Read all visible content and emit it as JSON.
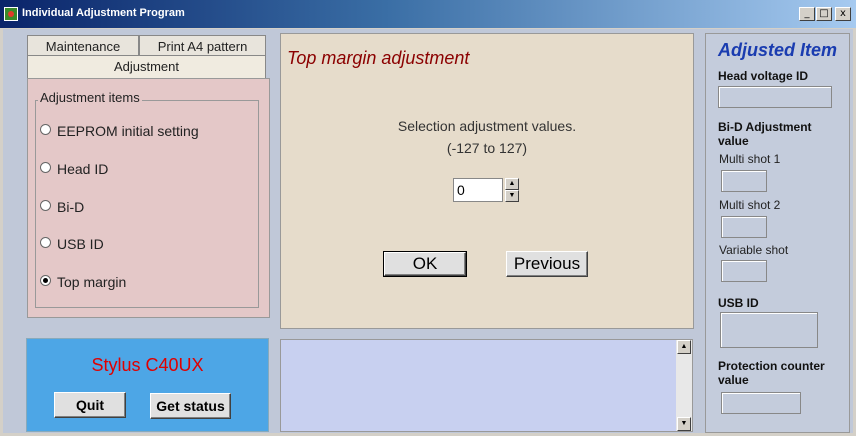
{
  "window": {
    "title": "Individual Adjustment Program",
    "minimize": "_",
    "maximize": "□",
    "close": "x"
  },
  "tabs": {
    "maintenance": "Maintenance",
    "print_a4": "Print A4 pattern",
    "adjustment": "Adjustment"
  },
  "adjustment_items": {
    "group_title": "Adjustment items",
    "items": [
      {
        "label": "EEPROM initial setting",
        "selected": false
      },
      {
        "label": "Head ID",
        "selected": false
      },
      {
        "label": "Bi-D",
        "selected": false
      },
      {
        "label": "USB ID",
        "selected": false
      },
      {
        "label": "Top margin",
        "selected": true
      }
    ]
  },
  "main": {
    "title": "Top margin adjustment",
    "instruction": "Selection adjustment values.",
    "range": "(-127 to 127)",
    "value": "0",
    "ok_label": "OK",
    "previous_label": "Previous"
  },
  "bottom": {
    "model": "Stylus C40UX",
    "quit_label": "Quit",
    "get_status_label": "Get status"
  },
  "adjusted": {
    "title": "Adjusted Item",
    "head_voltage_label": "Head voltage ID",
    "bid_label": "Bi-D Adjustment value",
    "multi1_label": "Multi shot 1",
    "multi2_label": "Multi shot 2",
    "variable_label": "Variable shot",
    "usb_label": "USB ID",
    "protection_label": "Protection counter value"
  },
  "colors": {
    "accent_title": "#8b0000",
    "model_text": "#e00000",
    "adjusted_title": "#1a3cb0"
  }
}
